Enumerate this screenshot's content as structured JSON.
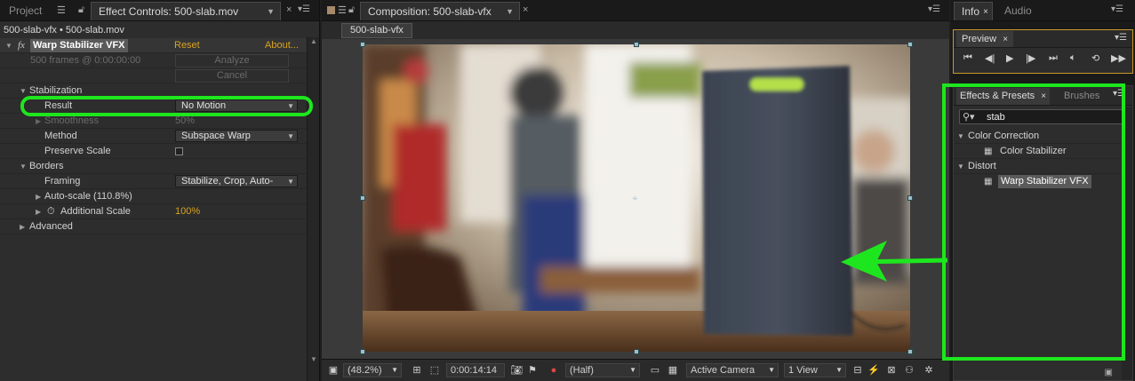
{
  "left_panel": {
    "tab_project": "Project",
    "tab_effect_controls": "Effect Controls: 500-slab.mov",
    "breadcrumb": "500-slab-vfx • 500-slab.mov",
    "effect_badge": "fx",
    "effect_name": "Warp Stabilizer VFX",
    "reset": "Reset",
    "about": "About...",
    "frames_status": "500 frames @ 0:00:00:00",
    "analyze_btn": "Analyze",
    "cancel_btn": "Cancel",
    "stabilization": "Stabilization",
    "result_label": "Result",
    "result_value": "No Motion",
    "smoothness_label": "Smoothness",
    "smoothness_value": "50%",
    "method_label": "Method",
    "method_value": "Subspace Warp",
    "preserve_scale_label": "Preserve Scale",
    "borders": "Borders",
    "framing_label": "Framing",
    "framing_value": "Stabilize, Crop, Auto-",
    "autoscale_label": "Auto-scale (110.8%)",
    "additional_scale_label": "Additional Scale",
    "additional_scale_value": "100%",
    "advanced": "Advanced"
  },
  "center_panel": {
    "tab_composition": "Composition: 500-slab-vfx",
    "comp_name_tab": "500-slab-vfx",
    "zoom": "(48.2%)",
    "timecode": "0:00:14:14",
    "resolution": "(Half)",
    "camera": "Active Camera",
    "views": "1 View"
  },
  "right_panel": {
    "tab_info": "Info",
    "tab_audio": "Audio",
    "preview_tab": "Preview",
    "effects_tab": "Effects & Presets",
    "brushes_tab": "Brushes",
    "search_value": "stab",
    "cat_color_correction": "Color Correction",
    "item_color_stabilizer": "Color Stabilizer",
    "cat_distort": "Distort",
    "item_warp_stabilizer": "Warp Stabilizer VFX"
  },
  "icons": {
    "lock": "lock-icon",
    "menu": "panel-menu-icon",
    "close": "close-icon",
    "search": "search-icon",
    "preset": "effect-preset-icon"
  },
  "colors": {
    "highlight_green": "#1ee61e",
    "orange_value": "#d9a31e"
  }
}
